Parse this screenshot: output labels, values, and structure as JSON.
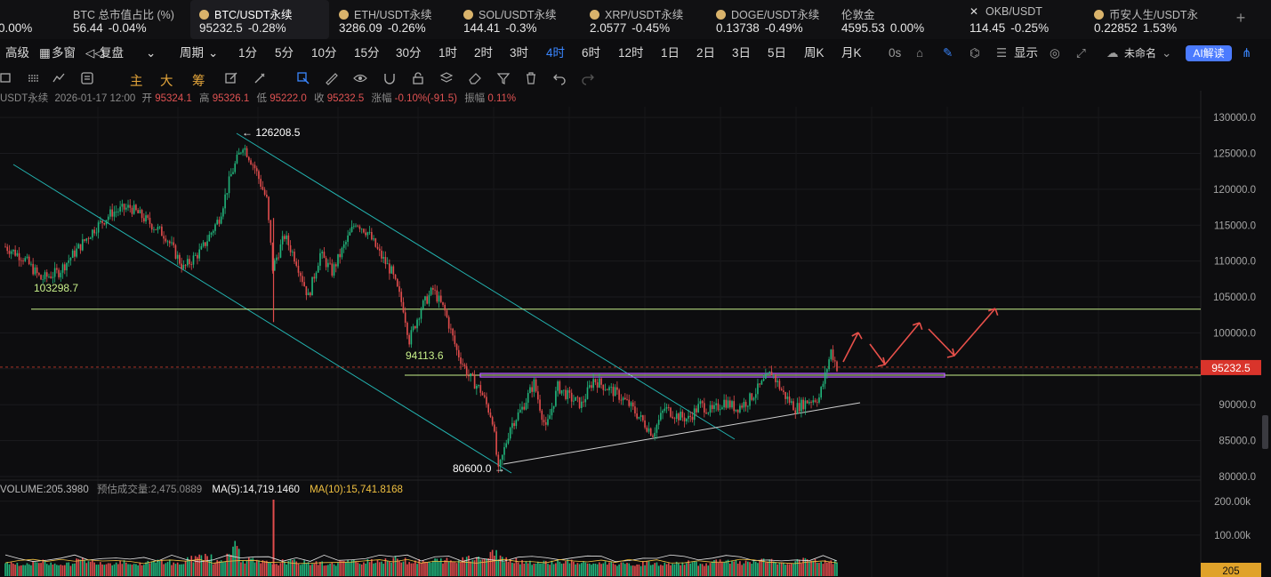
{
  "ticker": [
    {
      "name": "",
      "price": "",
      "change": "0.00%",
      "dir": "down",
      "icon": ""
    },
    {
      "name": "BTC 总市值占比 (%)",
      "price": "56.44",
      "change": "-0.04%",
      "dir": "down",
      "icon": ""
    },
    {
      "name": "BTC/USDT永续",
      "price": "95232.5",
      "change": "-0.28%",
      "dir": "down",
      "icon": "coin-dot",
      "active": true
    },
    {
      "name": "ETH/USDT永续",
      "price": "3286.09",
      "change": "-0.26%",
      "dir": "down",
      "icon": "coin-dot"
    },
    {
      "name": "SOL/USDT永续",
      "price": "144.41",
      "change": "-0.3%",
      "dir": "down",
      "icon": "coin-dot"
    },
    {
      "name": "XRP/USDT永续",
      "price": "2.0577",
      "change": "-0.45%",
      "dir": "up",
      "icon": "coin-dot"
    },
    {
      "name": "DOGE/USDT永续",
      "price": "0.13738",
      "change": "-0.49%",
      "dir": "up",
      "icon": "coin-dot"
    },
    {
      "name": "伦敦金",
      "price": "4595.53",
      "change": "0.00%",
      "dir": "down",
      "icon": ""
    },
    {
      "name": "OKB/USDT",
      "price": "114.45",
      "change": "-0.25%",
      "dir": "down",
      "icon": "x-mark"
    },
    {
      "name": "币安人生/USDT永",
      "price": "0.22852",
      "change": "1.53%",
      "dir": "up",
      "icon": "coin-dot"
    }
  ],
  "toolbar": {
    "left_items": [
      "高级",
      "多窗",
      "复盘"
    ],
    "period_label": "周期",
    "timeframes": [
      "1分",
      "5分",
      "10分",
      "15分",
      "30分",
      "1时",
      "2时",
      "3时",
      "4时",
      "6时",
      "12时",
      "1日",
      "2日",
      "3日",
      "5日",
      "周K",
      "月K"
    ],
    "active_timeframe": "4时",
    "seconds_label": "0s",
    "display_label": "显示",
    "layout_name": "未命名",
    "ai_label": "AI解读"
  },
  "drawing_toolbar": {
    "indicator_labels": [
      "主",
      "大",
      "筹"
    ]
  },
  "info": {
    "symbol": "USDT永续",
    "datetime": "2026-01-17 12:00",
    "open_label": "开",
    "open": "95324.1",
    "high_label": "高",
    "high": "95326.1",
    "low_label": "低",
    "low": "95222.0",
    "close_label": "收",
    "close": "95232.5",
    "change_label": "涨幅",
    "change": "-0.10%(-91.5)",
    "amplitude_label": "振幅",
    "amplitude": "0.11%"
  },
  "volume_info": {
    "volume_label": "VOLUME:205.3980",
    "estimate_label": "预估成交量:2,475.0889",
    "ma5": "MA(5):14,719.1460",
    "ma10": "MA(10):15,741.8168"
  },
  "chart_data": {
    "type": "candlestick",
    "price_axis": {
      "ticks": [
        130000,
        125000,
        120000,
        115000,
        110000,
        105000,
        100000,
        95000,
        90000,
        85000,
        80000
      ],
      "tick_labels": [
        "130000.0",
        "125000.0",
        "120000.0",
        "115000.0",
        "110000.0",
        "105000.0",
        "100000.0",
        "95000.0",
        "90000.0",
        "85000.0",
        "80000.0"
      ],
      "range": [
        79500,
        131500
      ]
    },
    "volume_axis": {
      "tick_labels": [
        "200.00k",
        "100.00k"
      ],
      "ticks": [
        200000,
        100000
      ],
      "current_volume_label": "205"
    },
    "current_price": "95232.5",
    "annotations": [
      {
        "label": "126208.5",
        "value": 126208.5,
        "kind": "high"
      },
      {
        "label": "80600.0",
        "value": 80600.0,
        "kind": "low"
      },
      {
        "label": "103298.7",
        "value": 103298.7,
        "kind": "horizontal-level",
        "color": "#b8e986"
      },
      {
        "label": "94113.6",
        "value": 94113.6,
        "kind": "horizontal-level",
        "color": "#b8e986"
      }
    ],
    "price_path": [
      [
        0,
        112000
      ],
      [
        3,
        110500
      ],
      [
        6,
        107500
      ],
      [
        9,
        108500
      ],
      [
        12,
        111500
      ],
      [
        15,
        114500
      ],
      [
        18,
        116800
      ],
      [
        21,
        117500
      ],
      [
        24,
        115500
      ],
      [
        27,
        113500
      ],
      [
        30,
        109000
      ],
      [
        33,
        111500
      ],
      [
        36,
        116000
      ],
      [
        38,
        122000
      ],
      [
        40,
        126208.5
      ],
      [
        42,
        123000
      ],
      [
        44,
        118500
      ],
      [
        45,
        109000
      ],
      [
        47,
        113500
      ],
      [
        49,
        110000
      ],
      [
        51,
        105000
      ],
      [
        53,
        111000
      ],
      [
        55,
        108500
      ],
      [
        57,
        112000
      ],
      [
        59,
        115500
      ],
      [
        61,
        114000
      ],
      [
        63,
        111000
      ],
      [
        65,
        108500
      ],
      [
        67,
        103500
      ],
      [
        68,
        99000
      ],
      [
        70,
        103500
      ],
      [
        72,
        106000
      ],
      [
        74,
        103000
      ],
      [
        76,
        97500
      ],
      [
        78,
        94000
      ],
      [
        80,
        92000
      ],
      [
        82,
        88000
      ],
      [
        83,
        80600
      ],
      [
        85,
        87000
      ],
      [
        87,
        89500
      ],
      [
        89,
        93000
      ],
      [
        91,
        86500
      ],
      [
        93,
        92500
      ],
      [
        95,
        91000
      ],
      [
        97,
        90000
      ],
      [
        99,
        93500
      ],
      [
        101,
        92500
      ],
      [
        103,
        91500
      ],
      [
        105,
        90000
      ],
      [
        107,
        88000
      ],
      [
        109,
        86000
      ],
      [
        111,
        89500
      ],
      [
        113,
        88500
      ],
      [
        115,
        88000
      ],
      [
        117,
        90000
      ],
      [
        119,
        89000
      ],
      [
        121,
        90500
      ],
      [
        123,
        89500
      ],
      [
        125,
        90500
      ],
      [
        127,
        92500
      ],
      [
        129,
        94500
      ],
      [
        131,
        91500
      ],
      [
        133,
        89500
      ],
      [
        135,
        90500
      ],
      [
        137,
        91000
      ],
      [
        138,
        94000
      ],
      [
        139,
        97500
      ],
      [
        140,
        95232.5
      ]
    ],
    "volume_levels": [
      0.25,
      0.18,
      0.3,
      0.22,
      0.2,
      0.35,
      0.28,
      0.24,
      0.3,
      0.2,
      0.26,
      0.32,
      0.22,
      0.4,
      0.55,
      0.3,
      0.9,
      0.35,
      0.28,
      0.22,
      0.3,
      0.26,
      0.24,
      0.2,
      0.3,
      0.28,
      0.35,
      0.32,
      0.4,
      0.3,
      0.28,
      0.35,
      0.3,
      0.5,
      0.45,
      0.6,
      0.38,
      0.3,
      0.26,
      0.28,
      0.3,
      0.24,
      0.22,
      0.26,
      0.2,
      0.18,
      0.24,
      0.2,
      0.22,
      0.26,
      0.2,
      0.3,
      0.28,
      0.25,
      0.32,
      0.3,
      0.22,
      0.35,
      0.3,
      0.28
    ],
    "colors": {
      "up": "#21b47b",
      "down": "#e04c4c",
      "channel": "#23b3b0",
      "support": "#cfcfcf",
      "resistance": "#c8f08a",
      "purple": "#b657ff",
      "arrow": "#e8504a"
    }
  }
}
